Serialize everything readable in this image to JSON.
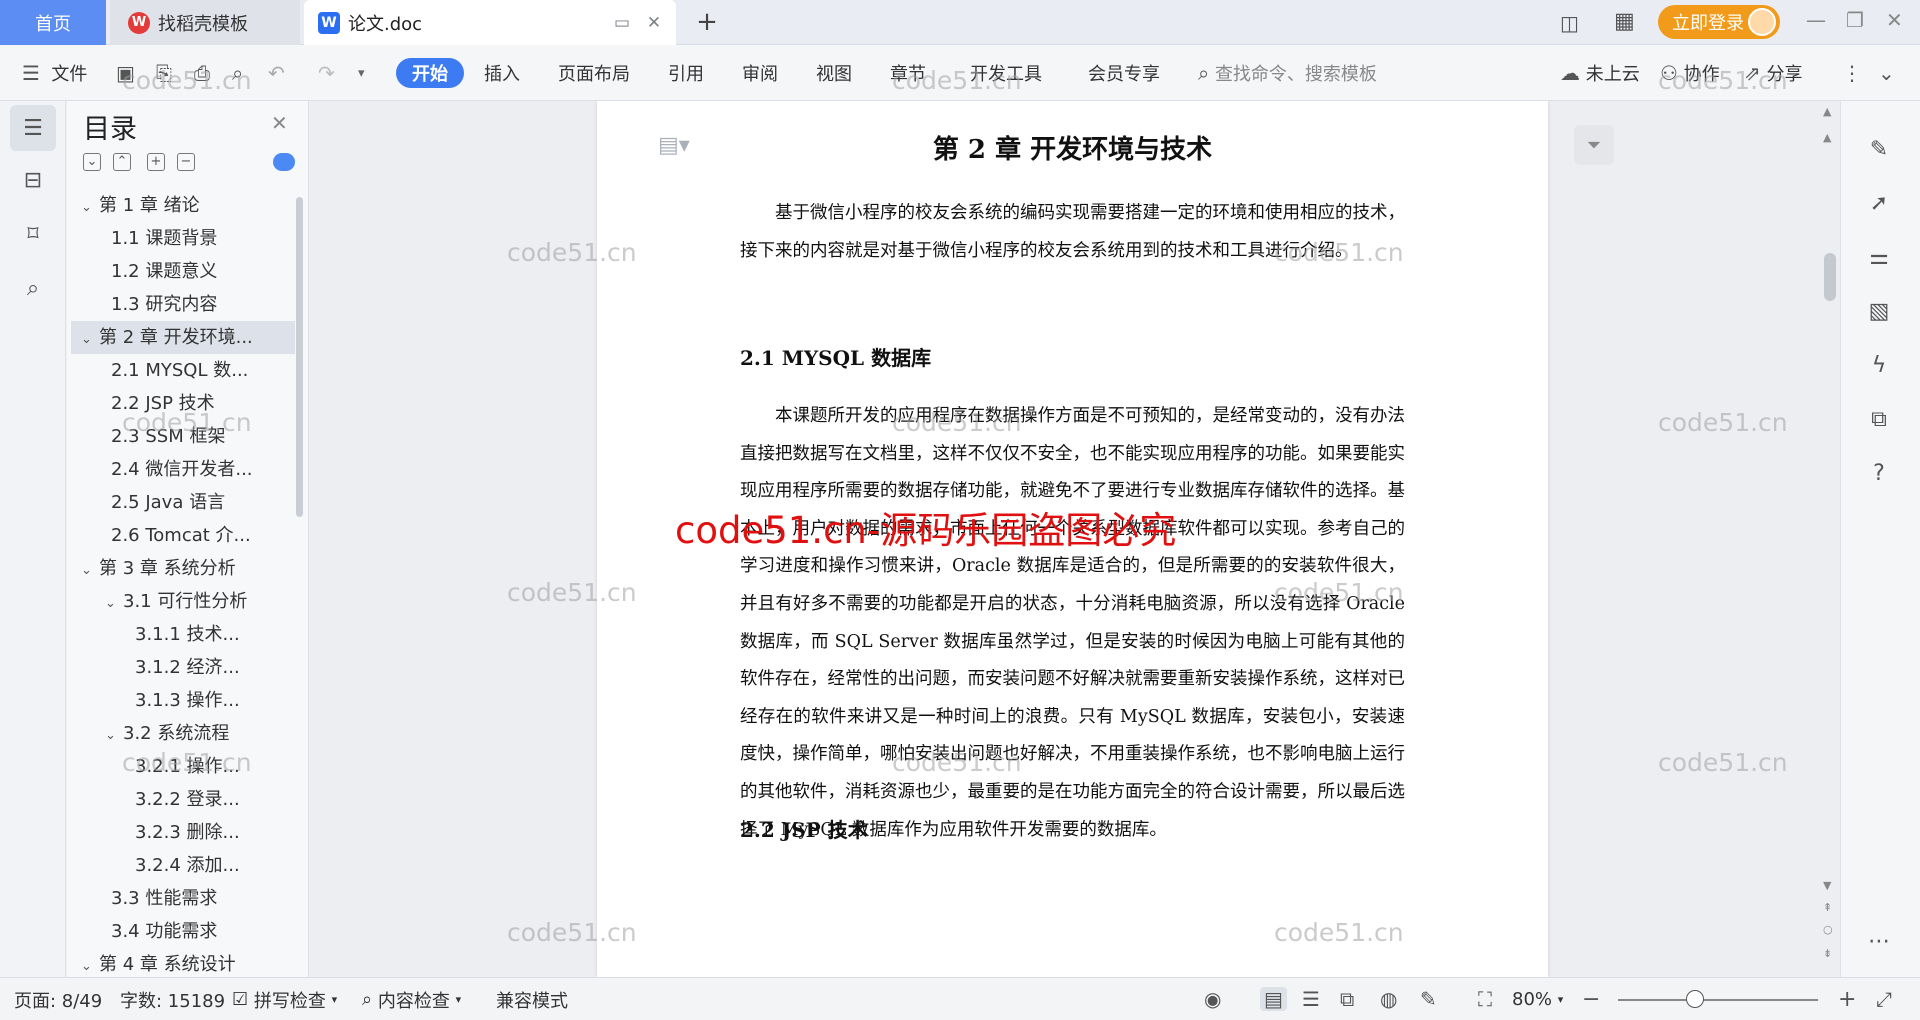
{
  "tabs": {
    "home": "首页",
    "templates": "找稻壳模板",
    "document": "论文.doc",
    "login": "立即登录"
  },
  "ribbon": {
    "file": "文件",
    "menus": [
      "开始",
      "插入",
      "页面布局",
      "引用",
      "审阅",
      "视图",
      "章节",
      "开发工具",
      "会员专享"
    ],
    "search_placeholder": "查找命令、搜索模板",
    "cloud": "未上云",
    "collab": "协作",
    "share": "分享"
  },
  "toc": {
    "title": "目录",
    "items": [
      {
        "label": "第 1 章  绪论",
        "level": 0,
        "arrow": "down"
      },
      {
        "label": "1.1  课题背景",
        "level": 1,
        "arrow": ""
      },
      {
        "label": "1.2  课题意义",
        "level": 1,
        "arrow": ""
      },
      {
        "label": "1.3  研究内容",
        "level": 1,
        "arrow": ""
      },
      {
        "label": "第 2 章  开发环境...",
        "level": 0,
        "arrow": "down",
        "active": true
      },
      {
        "label": "2.1 MYSQL 数...",
        "level": 1,
        "arrow": ""
      },
      {
        "label": "2.2 JSP 技术",
        "level": 1,
        "arrow": ""
      },
      {
        "label": "2.3 SSM 框架",
        "level": 1,
        "arrow": ""
      },
      {
        "label": "2.4 微信开发者...",
        "level": 1,
        "arrow": ""
      },
      {
        "label": "2.5 Java 语言",
        "level": 1,
        "arrow": ""
      },
      {
        "label": "2.6 Tomcat 介...",
        "level": 1,
        "arrow": ""
      },
      {
        "label": "第 3 章  系统分析",
        "level": 0,
        "arrow": "down"
      },
      {
        "label": "3.1  可行性分析",
        "level": 1,
        "arrow": "down"
      },
      {
        "label": "3.1.1  技术...",
        "level": 2,
        "arrow": ""
      },
      {
        "label": "3.1.2  经济...",
        "level": 2,
        "arrow": ""
      },
      {
        "label": "3.1.3  操作...",
        "level": 2,
        "arrow": ""
      },
      {
        "label": "3.2  系统流程",
        "level": 1,
        "arrow": "down"
      },
      {
        "label": "3.2.1  操作...",
        "level": 2,
        "arrow": ""
      },
      {
        "label": "3.2.2  登录...",
        "level": 2,
        "arrow": ""
      },
      {
        "label": "3.2.3  删除...",
        "level": 2,
        "arrow": ""
      },
      {
        "label": "3.2.4  添加...",
        "level": 2,
        "arrow": ""
      },
      {
        "label": "3.3  性能需求",
        "level": 1,
        "arrow": ""
      },
      {
        "label": "3.4  功能需求",
        "level": 1,
        "arrow": ""
      },
      {
        "label": "第 4 章  系统设计",
        "level": 0,
        "arrow": "down"
      }
    ]
  },
  "document": {
    "chapter_title": "第 2 章   开发环境与技术",
    "intro": "基于微信小程序的校友会系统的编码实现需要搭建一定的环境和使用相应的技术，接下来的内容就是对基于微信小程序的校友会系统用到的技术和工具进行介绍。",
    "section1_title": "2.1 MYSQL 数据库",
    "section1_body": "本课题所开发的应用程序在数据操作方面是不可预知的，是经常变动的，没有办法直接把数据写在文档里，这样不仅仅不安全，也不能实现应用程序的功能。如果要能实现应用程序所需要的数据存储功能，就避免不了要进行专业数据库存储软件的选择。基本上，用户对数据的需求，市面上任何一个关系型数据库软件都可以实现。参考自己的学习进度和操作习惯来讲，Oracle 数据库是适合的，但是所需要的的安装软件很大，并且有好多不需要的功能都是开启的状态，十分消耗电脑资源，所以没有选择 Oracle 数据库，而 SQL Server 数据库虽然学过，但是安装的时候因为电脑上可能有其他的软件存在，经常性的出问题，而安装问题不好解决就需要重新安装操作系统，这样对已经存在的软件来讲又是一种时间上的浪费。只有 MySQL 数据库，安装包小，安装速度快，操作简单，哪怕安装出问题也好解决，不用重装操作系统，也不影响电脑上运行的其他软件，消耗资源也少，最重要的是在功能方面完全的符合设计需要，所以最后选择了 MySQL 数据库作为应用软件开发需要的数据库。",
    "section2_title": "2.2 JSP 技术"
  },
  "watermarks": {
    "small": "code51.cn",
    "main": "code51.cn-源码乐园盗图必究"
  },
  "status": {
    "page": "页面: 8/49",
    "words": "字数: 15189",
    "spell": "拼写检查",
    "content_check": "内容检查",
    "compat": "兼容模式",
    "zoom": "80%"
  },
  "colors": {
    "accent": "#3c7bf2",
    "home_tab": "#5b8df2",
    "login": "#f29b1a",
    "watermark_main": "#e01010"
  }
}
